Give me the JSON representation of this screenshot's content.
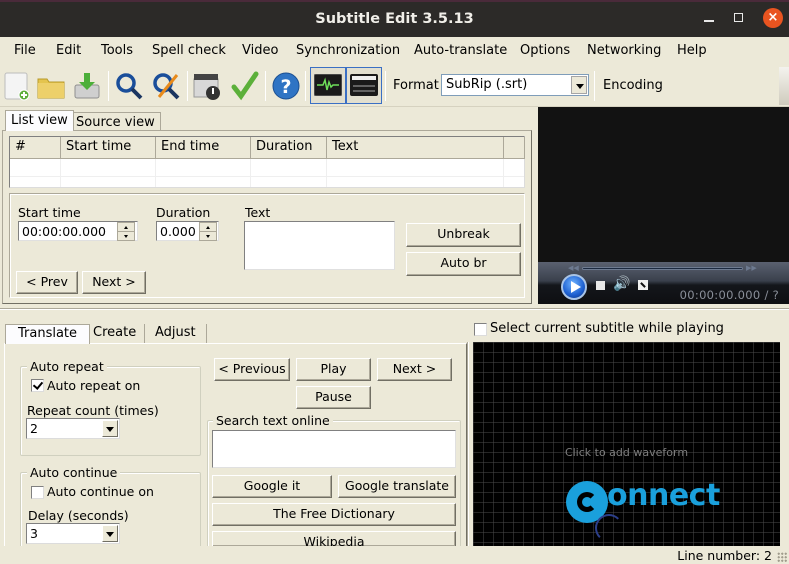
{
  "window": {
    "title": "Subtitle Edit 3.5.13",
    "close_color": "#e95420"
  },
  "menu": [
    "File",
    "Edit",
    "Tools",
    "Spell check",
    "Video",
    "Synchronization",
    "Auto-translate",
    "Options",
    "Networking",
    "Help"
  ],
  "toolbar": {
    "icons": [
      "new-file-icon",
      "open-folder-icon",
      "save-download-icon",
      "find-icon",
      "replace-icon",
      "visual-sync-icon",
      "spell-check-icon",
      "help-icon",
      "waveform-toggle-icon",
      "video-toggle-icon"
    ],
    "format_label": "Format",
    "format_value": "SubRip (.srt)",
    "encoding_label": "Encoding"
  },
  "top_tabs": [
    "List view",
    "Source view"
  ],
  "grid": {
    "columns": [
      "#",
      "Start time",
      "End time",
      "Duration",
      "Text"
    ],
    "rows": []
  },
  "editor": {
    "start_time_label": "Start time",
    "start_time_value": "00:00:00.000",
    "duration_label": "Duration",
    "duration_value": "0.000",
    "text_label": "Text",
    "text_value": "",
    "unbreak": "Unbreak",
    "auto_br": "Auto br",
    "prev": "< Prev",
    "next": "Next >"
  },
  "video": {
    "time": "00:00:00.000 / ?"
  },
  "bottom_tabs": [
    "Translate",
    "Create",
    "Adjust"
  ],
  "translate": {
    "auto_repeat_title": "Auto repeat",
    "auto_repeat_on": "Auto repeat on",
    "auto_repeat_checked": true,
    "repeat_count_label": "Repeat count (times)",
    "repeat_count_value": "2",
    "auto_continue_title": "Auto continue",
    "auto_continue_on": "Auto continue on",
    "auto_continue_checked": false,
    "delay_label": "Delay (seconds)",
    "delay_value": "3",
    "previous": "< Previous",
    "play": "Play",
    "next": "Next >",
    "pause": "Pause",
    "search_title": "Search text online",
    "search_value": "",
    "google_it": "Google it",
    "google_translate": "Google translate",
    "free_dictionary": "The Free Dictionary",
    "wikipedia": "Wikipedia"
  },
  "waveform": {
    "select_current": "Select current subtitle while playing",
    "select_current_checked": false,
    "hint": "Click to add waveform",
    "watermark": "onnect",
    "watermark_color": "#1aa0dc"
  },
  "status": {
    "line_number": "Line number: 2"
  }
}
